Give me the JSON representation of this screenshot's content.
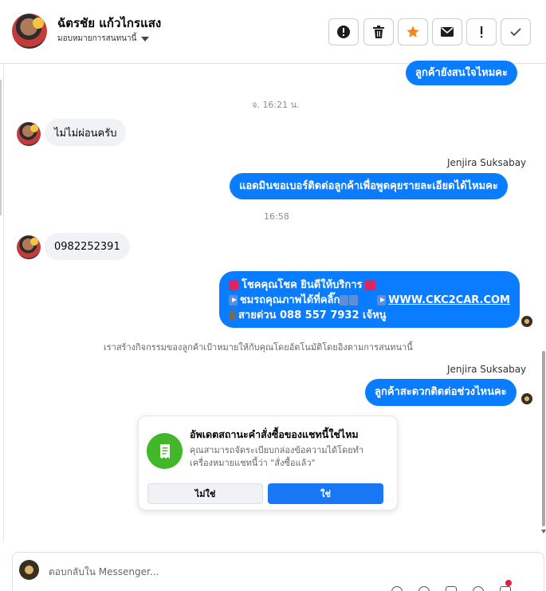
{
  "header": {
    "contact_name": "ฉัตรชัย แก้วไกรแสง",
    "assign_label": "มอบหมายการสนทนานี้",
    "actions": [
      {
        "name": "spam-button",
        "icon": "alert-circle-icon"
      },
      {
        "name": "delete-button",
        "icon": "trash-icon"
      },
      {
        "name": "star-button",
        "icon": "star-icon",
        "color": "#f5861f"
      },
      {
        "name": "mark-unread-button",
        "icon": "envelope-icon"
      },
      {
        "name": "follow-up-button",
        "icon": "exclamation-icon"
      },
      {
        "name": "mark-done-button",
        "icon": "check-icon"
      }
    ]
  },
  "messages": {
    "m1_out": "ลูกค้ายังสนใจไหมคะ",
    "ts1": "จ. 16:21 น.",
    "m2_in": "ไม่ไม่ผ่อนครับ",
    "sender1": "Jenjira Suksabay",
    "m3_out": "แอดมินขอเบอร์ติดต่อลูกค้าเพื่อพูดคุยรายละเอียดได้ไหมคะ",
    "ts2": "16:58",
    "m4_in": "0982252391",
    "m5_line1": "โชคคุณโชค ยินดีให้บริการ",
    "m5_line2": "ชมรถคุณภาพได้ที่คลิ๊ก",
    "m5_link": "WWW.CKC2CAR.COM",
    "m5_line3": "สายด่วน 088 557 7932 เจ้หนู",
    "system_note": "เราสร้างกิจกรรมของลูกค้าเป้าหมายให้กับคุณโดยอัตโนมัติโดยอิงตามการสนทนานี้",
    "sender2": "Jenjira Suksabay",
    "m6_out": "ลูกค้าสะดวกติดต่อช่วงไหนคะ"
  },
  "card": {
    "title": "อัพเดตสถานะคำสั่งซื้อของแชทนี้ใช่ไหม",
    "description": "คุณสามารถจัดระเบียบกล่องข้อความได้โดยทำเครื่องหมายแชทนี้ว่า \"สั่งซื้อแล้ว\"",
    "no_label": "ไม่ใช่",
    "yes_label": "ใช่",
    "icon": "receipt-icon"
  },
  "composer": {
    "placeholder": "ตอบกลับใน Messenger..."
  },
  "colors": {
    "outgoing_bubble": "#0a7cff",
    "incoming_bubble": "#f0f2f5",
    "primary_button": "#1877f2",
    "card_icon_bg": "#42b72a"
  }
}
